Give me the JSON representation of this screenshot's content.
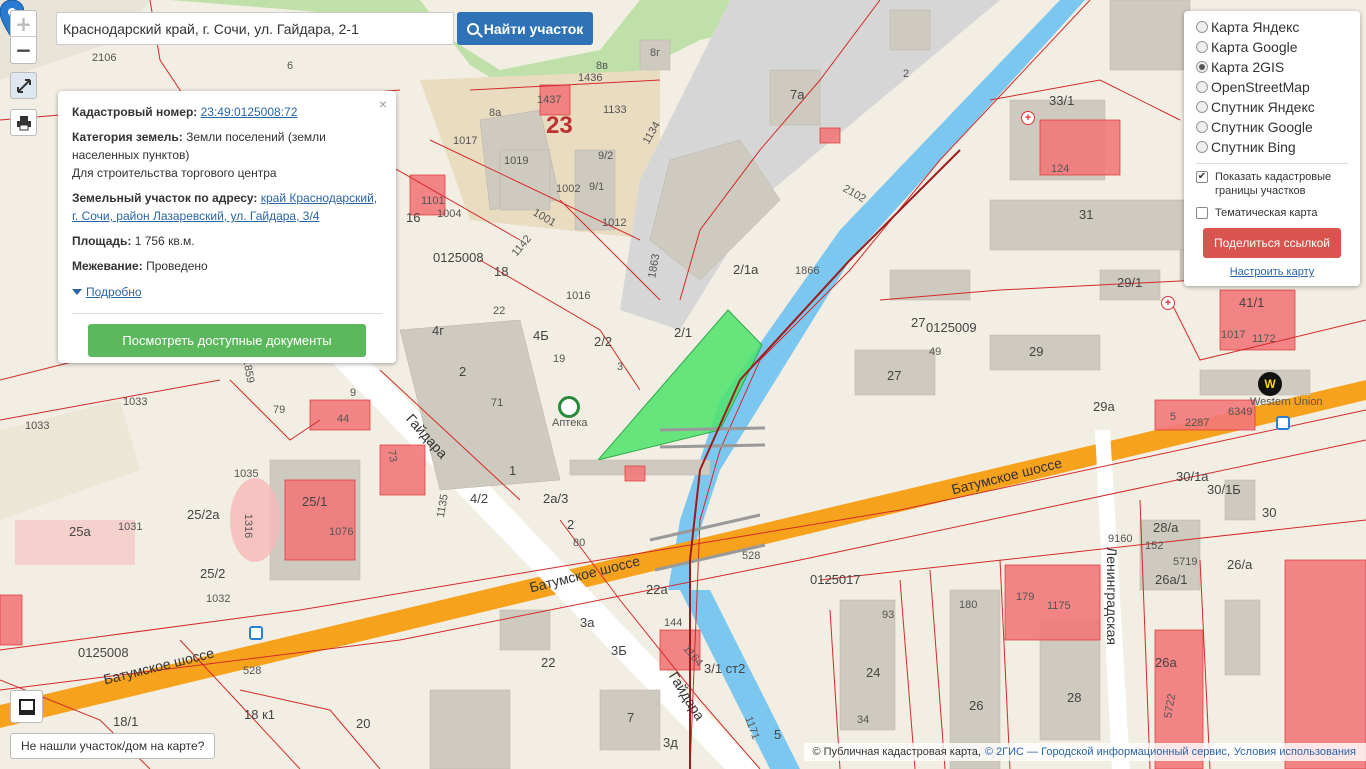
{
  "search": {
    "value": "Краснодарский край, г. Сочи, ул. Гайдара, 2-1",
    "button_label": "Найти участок"
  },
  "zoom": {
    "plus": "+",
    "minus": "−"
  },
  "popup": {
    "cadastral_label": "Кадастровый номер:",
    "cadastral_value": "23:49:0125008:72",
    "category_label": "Категория земель:",
    "category_value": "Земли поселений (земли населенных пунктов)",
    "category_purpose": "Для строительства торгового центра",
    "address_label": "Земельный участок по адресу:",
    "address_value": "край Краснодарский, г. Сочи, район Лазаревский, ул. Гайдара, 3/4",
    "area_label": "Площадь:",
    "area_value": "1 756 кв.м.",
    "survey_label": "Межевание:",
    "survey_value": "Проведено",
    "more_label": "Подробно",
    "docs_button": "Посмотреть доступные документы",
    "close": "×"
  },
  "layers": {
    "options": [
      {
        "label": "Карта Яндекс",
        "selected": false
      },
      {
        "label": "Карта Google",
        "selected": false
      },
      {
        "label": "Карта 2GIS",
        "selected": true
      },
      {
        "label": "OpenStreetMap",
        "selected": false
      },
      {
        "label": "Спутник Яндекс",
        "selected": false
      },
      {
        "label": "Спутник Google",
        "selected": false
      },
      {
        "label": "Спутник Bing",
        "selected": false
      }
    ],
    "show_borders_label": "Показать кадастровые границы участков",
    "show_borders_checked": true,
    "thematic_label": "Тематическая карта",
    "thematic_checked": false,
    "share_button": "Поделиться ссылкой",
    "setup_link": "Настроить карту"
  },
  "not_found_button": "Не нашли участок/дом на карте?",
  "attribution": {
    "prefix": "© Публичная кадастровая карта,",
    "gis": "© 2ГИС — Городской информационный сервис,",
    "terms": "Условия использования"
  },
  "map_labels": {
    "quarter_23": "23",
    "q_0125008_a": "0125008",
    "q_0125008_b": "0125008",
    "q_0125009": "0125009",
    "q_0125017": "0125017",
    "street_gaidara_1": "Гайдара",
    "street_gaidara_2": "Гайдара",
    "street_batum_1": "Батумское шоссе",
    "street_batum_2": "Батумское шоссе",
    "street_batum_3": "Батумское шоссе",
    "street_leningrad": "Ленинградская",
    "apteka": "Аптека",
    "western": "Western Union",
    "b_2106": "2106",
    "b_6": "6",
    "b_8v": "8в",
    "b_8g": "8г",
    "b_1436": "1436",
    "b_1437": "1437",
    "b_1133": "1133",
    "b_8a": "8а",
    "b_1017": "1017",
    "b_1019": "1019",
    "b_1134": "1134",
    "b_9_2": "9/2",
    "b_1002": "1002",
    "b_9_1": "9/1",
    "b_1012": "1012",
    "b_1001": "1001",
    "b_7a": "7а",
    "b_2": "2",
    "b_2102": "2102",
    "b_1863": "1863",
    "b_2_1a": "2/1а",
    "b_1866": "1866",
    "b_2_1": "2/1",
    "b_18": "18",
    "b_1142": "1142",
    "b_16": "16",
    "b_1004": "1004",
    "b_1016": "1016",
    "b_22": "22",
    "b_4g": "4г",
    "b_4b": "4Б",
    "b_19": "19",
    "b_2_2": "2/2",
    "b_3": "3",
    "b_71": "71",
    "b_1": "1",
    "b_79": "79",
    "b_9": "9",
    "b_44": "44",
    "b_1033a": "1033",
    "b_1033b": "1033",
    "b_1035": "1035",
    "b_25_1": "25/1",
    "b_1076": "1076",
    "b_25a": "25а",
    "b_1031": "1031",
    "b_25_2a": "25/2а",
    "b_25_2": "25/2",
    "b_1032": "1032",
    "b_1316": "1316",
    "b_4_2": "4/2",
    "b_2a_3": "2а/3",
    "b_80": "80",
    "b_528a": "528",
    "b_528b": "528",
    "b_22a": "22а",
    "b_3a": "3а",
    "b_3b": "3Б",
    "b_22b": "22",
    "b_144": "144",
    "b_3_1": "3/1 ст2",
    "b_1164": "1164",
    "b_7": "7",
    "b_3d": "3д",
    "b_5": "5",
    "b_1171": "1171",
    "b_18k1": "18 к1",
    "b_18_1": "18/1",
    "b_20": "20",
    "b_33_1": "33/1",
    "b_124": "124",
    "b_31": "31",
    "b_29_1": "29/1",
    "b_41_1": "41/1",
    "b_1017b": "1017",
    "b_1172": "1172",
    "b_27a": "27",
    "b_49": "49",
    "b_27": "27",
    "b_29": "29",
    "b_29a": "29а",
    "b_5b": "5",
    "b_2287": "2287",
    "b_6349": "6349",
    "b_30_1a": "30/1а",
    "b_30_1b": "30/1Б",
    "b_30": "30",
    "b_28a": "28/а",
    "b_152": "152",
    "b_5719": "5719",
    "b_26a_1": "26а/1",
    "b_26a": "26/а",
    "b_9160": "9160",
    "b_93": "93",
    "b_180": "180",
    "b_179": "179",
    "b_1175": "1175",
    "b_24": "24",
    "b_26": "26",
    "b_28": "28",
    "b_34": "34",
    "b_26b": "26а",
    "b_5722": "5722",
    "b_2b": "2",
    "b_1859": "1859",
    "b_1101": "1101",
    "b_73": "73",
    "b_1135": "1135"
  }
}
